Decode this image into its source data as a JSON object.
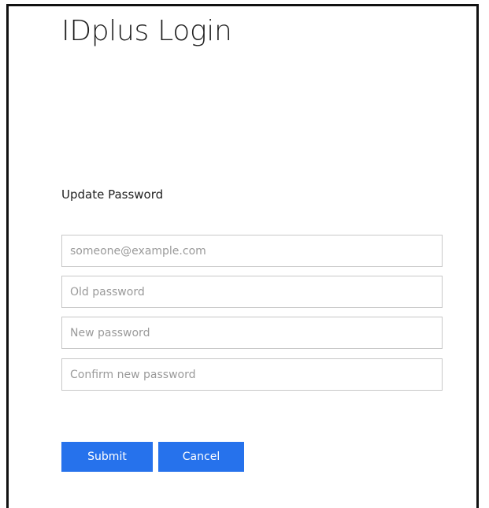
{
  "header": {
    "title": "IDplus Login"
  },
  "form": {
    "heading": "Update Password",
    "fields": {
      "email": {
        "value": "",
        "placeholder": "someone@example.com"
      },
      "old_password": {
        "value": "",
        "placeholder": "Old password"
      },
      "new_password": {
        "value": "",
        "placeholder": "New password"
      },
      "confirm_password": {
        "value": "",
        "placeholder": "Confirm new password"
      }
    },
    "buttons": {
      "submit_label": "Submit",
      "cancel_label": "Cancel"
    }
  },
  "colors": {
    "accent": "#2672ec",
    "border": "#c8c8c8",
    "frame": "#111111",
    "placeholder_text": "#9a9a9a"
  }
}
